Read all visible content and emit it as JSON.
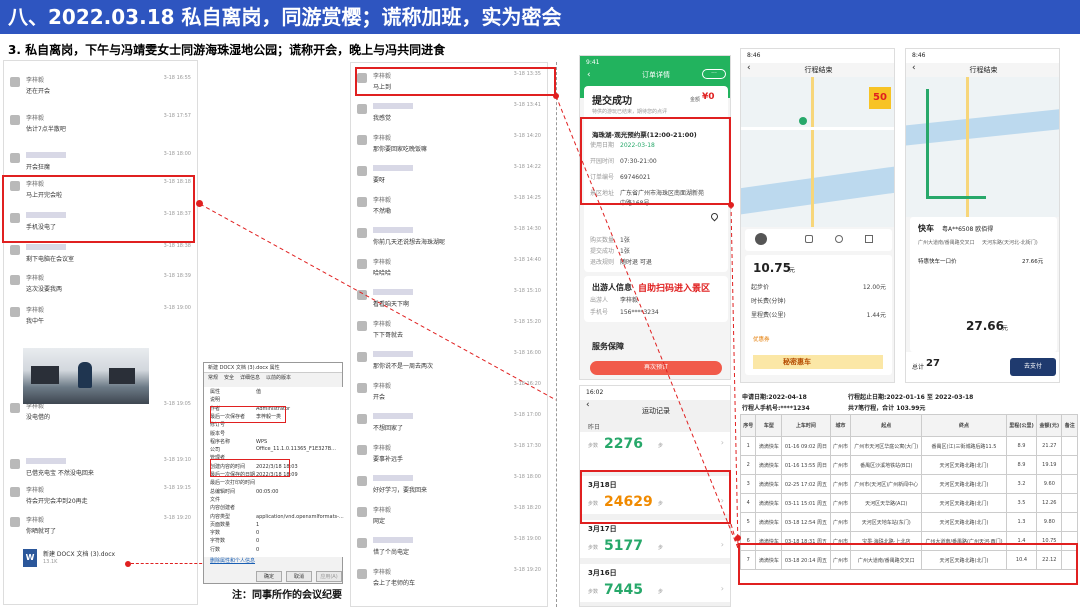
{
  "header": {
    "title": "八、2022.03.18  私自离岗，同游赏樱；谎称加班，实为密会"
  },
  "subtitle": "3. 私自离岗，下午与冯靖雯女士同游海珠湿地公园；谎称开会，晚上与冯共同进食",
  "caption": "注：同事所作的会议纪要",
  "chat_left": {
    "messages": [
      {
        "name": "李梓毅",
        "text": "还在开会",
        "time": "3-18 16:55"
      },
      {
        "name": "李梓毅",
        "text": "估计7点半散吧",
        "time": "3-18 17:57"
      },
      {
        "name": "",
        "text": "开会狂魔",
        "time": "3-18 18:00"
      },
      {
        "name": "李梓毅",
        "text": "马上开完会啦",
        "time": "3-18 18:18"
      },
      {
        "name": "",
        "text": "手机没电了",
        "time": "3-18 18:37"
      },
      {
        "name": "",
        "text": "剩下电脑在会议室",
        "time": "3-18 18:38"
      },
      {
        "name": "李梓毅",
        "text": "这次没要我两",
        "time": "3-18 18:39"
      },
      {
        "name": "李梓毅",
        "text": "我中午",
        "time": "3-18 19:00"
      },
      {
        "name": "李梓毅",
        "text": "没电借的",
        "time": "3-18 19:05"
      },
      {
        "name": "",
        "text": "已借充电宝 不然没电回来",
        "time": "3-18 19:10"
      },
      {
        "name": "李梓毅",
        "text": "待会开完会冲到20再走",
        "time": "3-18 19:15"
      },
      {
        "name": "李梓毅",
        "text": "你晒就可了",
        "time": "3-18 19:20"
      }
    ],
    "file": {
      "name": "新建 DOCX 文档 (3).docx",
      "size": "13.1K"
    }
  },
  "dialog": {
    "title": "新建 DOCX 文档 (3).docx 属性",
    "tabs": [
      "常规",
      "安全",
      "详细信息",
      "以前的版本"
    ],
    "props": [
      [
        "属性",
        "值"
      ],
      [
        "说明",
        ""
      ],
      [
        "作者",
        "Administrator"
      ],
      [
        "最后一次保存者",
        "李梓毅一类"
      ],
      [
        "修订号",
        ""
      ],
      [
        "版本号",
        ""
      ],
      [
        "程序名称",
        "WPS Office_11.1.0.11365_F1E327B..."
      ],
      [
        "公司",
        ""
      ],
      [
        "管理者",
        ""
      ],
      [
        "创建内容的时间",
        "2022/3/18 18:03"
      ],
      [
        "最后一次保存的日期",
        "2022/3/18 18:09"
      ],
      [
        "最后一次打印的时间",
        ""
      ],
      [
        "总编辑时间",
        "00:05:00"
      ],
      [
        "文件",
        ""
      ],
      [
        "内容创建者",
        ""
      ],
      [
        "内容类型",
        "application/vnd.openxmlformats-..."
      ],
      [
        "页面数量",
        "1"
      ],
      [
        "字数",
        "0"
      ],
      [
        "字符数",
        "0"
      ],
      [
        "行数",
        "0"
      ]
    ],
    "link": "删除属性和个人信息",
    "buttons": [
      "确定",
      "取消",
      "应用(A)"
    ]
  },
  "chat_mid": {
    "messages": [
      {
        "text": "马上到",
        "time": "3-18 13:35"
      },
      {
        "text": "我感觉",
        "time": "3-18 13:41"
      },
      {
        "text": "那你要回家吃晚饭嘛",
        "time": "3-18 14:20"
      },
      {
        "text": "要呀",
        "time": "3-18 14:22"
      },
      {
        "text": "不然嘞",
        "time": "3-18 14:25"
      },
      {
        "text": "你前几天还说想去海珠湖呢",
        "time": "3-18 14:30"
      },
      {
        "text": "哈哈哈",
        "time": "3-18 14:40"
      },
      {
        "text": "看看咱天下啊",
        "time": "3-18 15:10"
      },
      {
        "text": "下下哥就去",
        "time": "3-18 15:20"
      },
      {
        "text": "那你说不是一周去两次",
        "time": "3-18 16:00"
      },
      {
        "text": "开会",
        "time": "3-18 16:20"
      },
      {
        "text": "不想回家了",
        "time": "3-18 17:00"
      },
      {
        "text": "要事补远手",
        "time": "3-18 17:30"
      },
      {
        "text": "好好学习，要我回来",
        "time": "3-18 18:00"
      },
      {
        "text": "网定",
        "time": "3-18 18:20"
      },
      {
        "text": "惜了个尚电定",
        "time": "3-18 19:00"
      },
      {
        "text": "会上了老师的车",
        "time": "3-18 19:20"
      }
    ],
    "sender": "李梓毅"
  },
  "order": {
    "status": "9:41",
    "nav": "订单详情",
    "title": "提交成功",
    "amount_label": "金额",
    "amount": "¥0",
    "desc": "特供的游玩已结束，期待您的点评",
    "ticket": "海珠湖-观光预约票(12:00-21:00)",
    "rows": [
      [
        "使用日期",
        "2022-03-18"
      ],
      [
        "开园时间",
        "07:30-21:00"
      ],
      [
        "订单编号",
        "69746021"
      ],
      [
        "景区地址",
        "广东省广州市海珠区南面湖新苑中路168号"
      ]
    ],
    "rows2": [
      [
        "购买数量",
        "1张"
      ],
      [
        "提交成功",
        "1张"
      ],
      [
        "退改规则",
        "随时退 可退"
      ]
    ],
    "visitor_title": "出游人信息",
    "highlight": "自助扫码进入景区",
    "visitor": [
      [
        "出游人",
        "李梓毅"
      ],
      [
        "手机号",
        "156****3234"
      ]
    ],
    "service": "服务保障",
    "button": "再次预订"
  },
  "steps": {
    "status": "16:02",
    "title": "运动记录",
    "today": "昨日",
    "days": [
      {
        "date": "",
        "value": "2276"
      },
      {
        "date": "3月18日",
        "value": "24629"
      },
      {
        "date": "3月17日",
        "value": "5177"
      },
      {
        "date": "3月16日",
        "value": "7445"
      }
    ],
    "unit": "步",
    "label": "步数"
  },
  "ride1": {
    "status": "8:46",
    "title": "行程结束",
    "price": "10.75",
    "unit": "元",
    "items": [
      [
        "起步价",
        "12.00元"
      ],
      [
        "时长费(分钟)",
        ""
      ],
      [
        "里程费(公里)",
        "1.44元"
      ]
    ],
    "coupon": "优惠券",
    "banner": "秘密惠车",
    "tag": "50"
  },
  "ride2": {
    "status": "8:46",
    "title": "行程结束",
    "car": "快车",
    "plate": "粤A**6508 欧佰得",
    "from": "广州大道南/番禺路交叉口",
    "to": "天河东路(天河北-北街门)",
    "item": "特惠快车一口价",
    "item_price": "27.66元",
    "total": "27.66",
    "total_unit": "元",
    "foot_total": "27",
    "foot_label": "总计",
    "pay": "去支付"
  },
  "report": {
    "meta": [
      [
        "申请日期:2022-04-18",
        "行程起止日期:2022-01-16 至 2022-03-18"
      ],
      [
        "行程人手机号:****1234",
        "共7笔行程，合计 103.99元"
      ]
    ],
    "headers": [
      "序号",
      "车型",
      "上车时间",
      "城市",
      "起点",
      "终点",
      "里程(公里)",
      "金额(元)",
      "备注"
    ],
    "rows": [
      [
        "1",
        "滴滴快车",
        "01-16 09:02 周日",
        "广州市",
        "广州市天河区华庭公寓(大门)",
        "番禺区(江)三街城路后路11.5",
        "8.9",
        "21.27",
        ""
      ],
      [
        "2",
        "滴滴快车",
        "01-16 13:55 周日",
        "广州市",
        "番禺区沙溪地铁站(B口)",
        "天河区天路北路(北门)",
        "8.9",
        "19.19",
        ""
      ],
      [
        "3",
        "滴滴快车",
        "02-25 17:02 周五",
        "广州市",
        "广州市(天河区)广州新闻中心",
        "天河区天路北路(北门)",
        "3.2",
        "9.60",
        ""
      ],
      [
        "4",
        "滴滴快车",
        "03-11 15:01 周五",
        "广州市",
        "天河区天华路(A口)",
        "天河区天路北路(北门)",
        "3.5",
        "12.26",
        ""
      ],
      [
        "5",
        "滴滴快车",
        "03-18 12:54 周五",
        "广州市",
        "天河区天地车站(东门)",
        "天河区天路北路(北门)",
        "1.3",
        "9.80",
        ""
      ],
      [
        "6",
        "滴滴快车",
        "03-18 18:31 周五",
        "广州市",
        "宝墨·海珠北路·上北店",
        "广州大道南/番禺路(广州天河·西门)",
        "1.4",
        "10.75",
        ""
      ],
      [
        "7",
        "滴滴快车",
        "03-18 20:14 周五",
        "广州市",
        "广州大道南/番禺路交叉口",
        "天河区天路北路(北门)",
        "10.4",
        "22.12",
        ""
      ]
    ]
  }
}
